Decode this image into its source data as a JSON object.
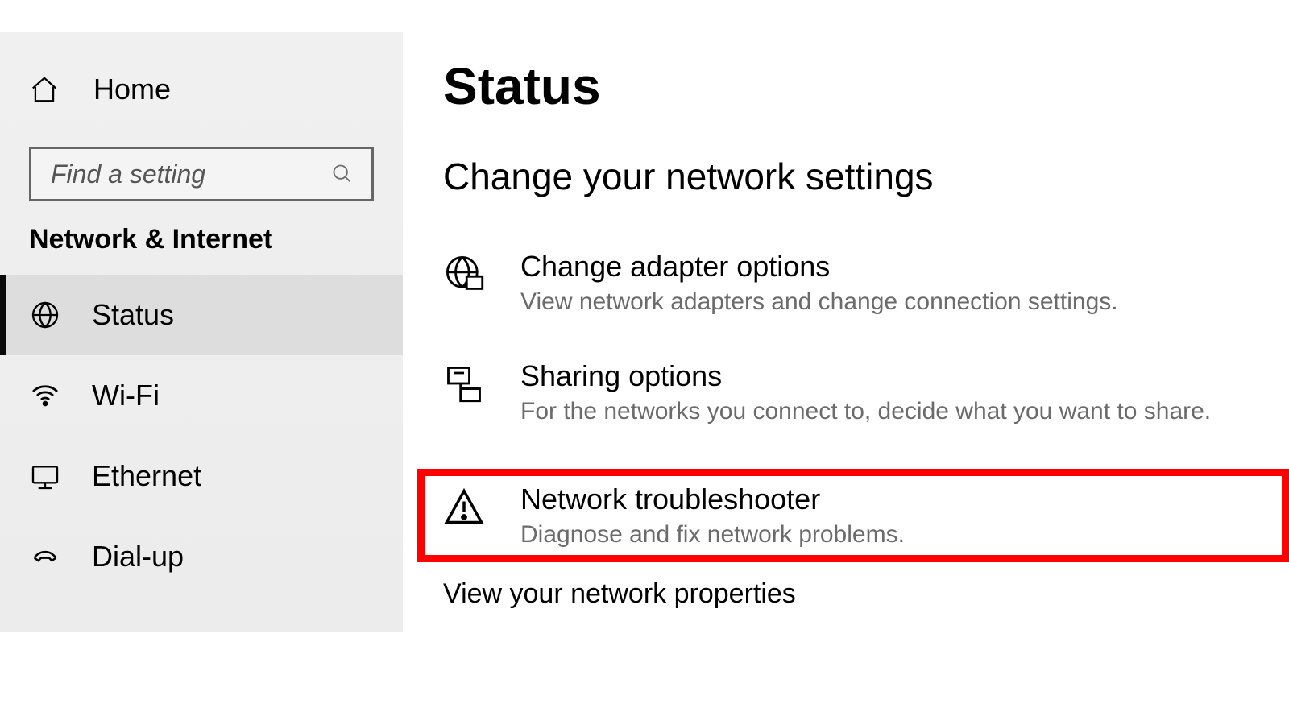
{
  "sidebar": {
    "home_label": "Home",
    "search_placeholder": "Find a setting",
    "category_label": "Network & Internet",
    "items": [
      {
        "label": "Status",
        "active": true
      },
      {
        "label": "Wi-Fi"
      },
      {
        "label": "Ethernet"
      },
      {
        "label": "Dial-up"
      }
    ]
  },
  "main": {
    "page_title": "Status",
    "section_title": "Change your network settings",
    "items": [
      {
        "title": "Change adapter options",
        "desc": "View network adapters and change connection settings."
      },
      {
        "title": "Sharing options",
        "desc": "For the networks you connect to, decide what you want to share."
      },
      {
        "title": "Network troubleshooter",
        "desc": "Diagnose and fix network problems.",
        "highlighted": true
      }
    ],
    "link": "View your network properties"
  },
  "colors": {
    "highlight": "#ff0000",
    "muted": "#6b6b6b"
  }
}
